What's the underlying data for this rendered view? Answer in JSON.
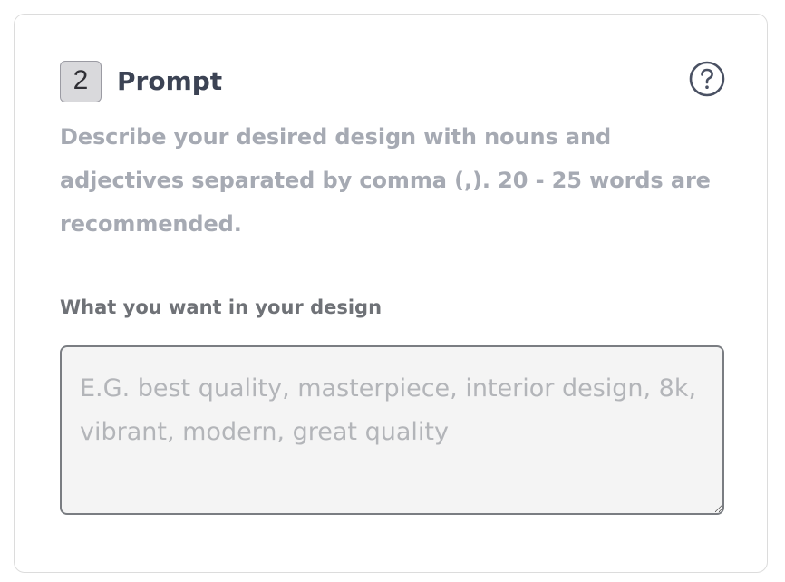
{
  "step": {
    "number": "2",
    "title": "Prompt"
  },
  "help": {
    "icon": "question-circle-icon"
  },
  "description": "Describe your desired design with nouns and adjectives separated by comma (,). 20 - 25 words are recommended.",
  "field": {
    "label": "What you want in your design",
    "placeholder": "E.G. best quality, masterpiece, interior design, 8k, vibrant, modern, great quality",
    "value": ""
  },
  "colors": {
    "badge_bg": "#d9d9dc",
    "title": "#3c4354",
    "description": "#a6aab3",
    "label": "#6f7277",
    "input_bg": "#f4f4f4",
    "input_border": "#7a7d82"
  }
}
